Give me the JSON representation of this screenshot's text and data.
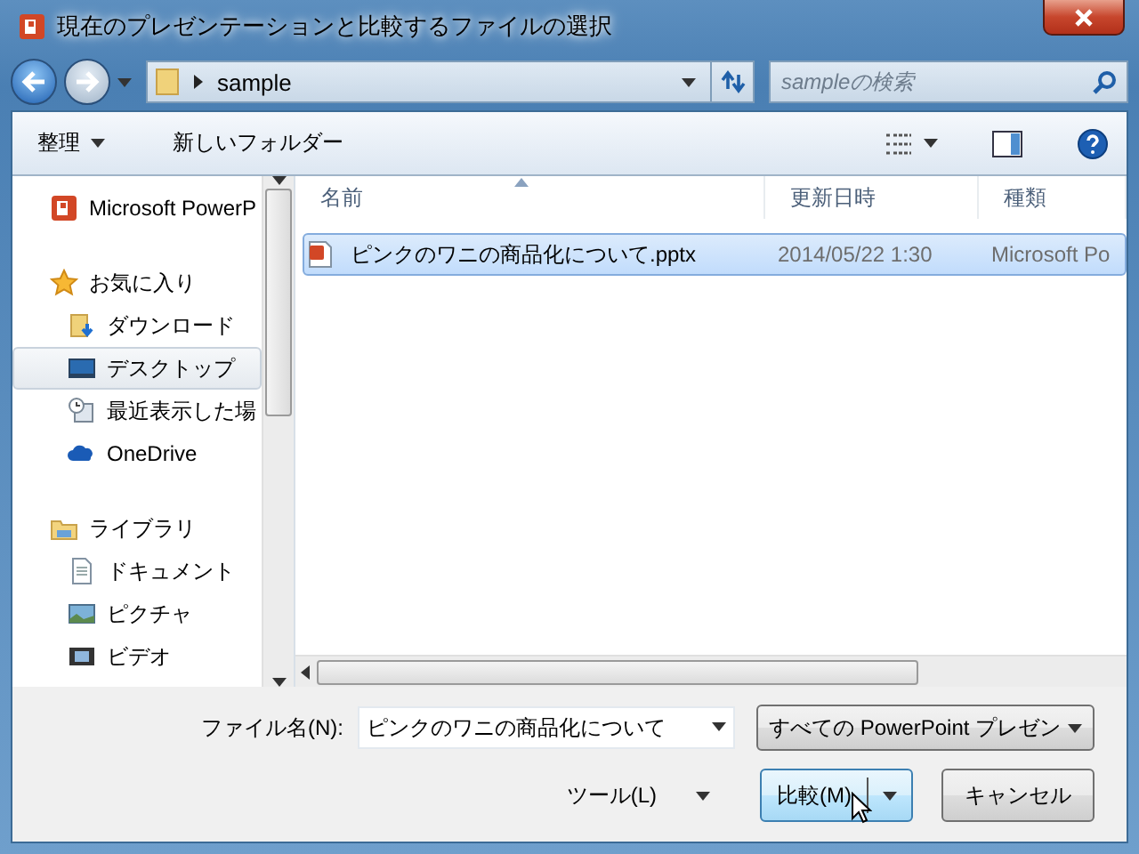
{
  "window": {
    "title": "現在のプレゼンテーションと比較するファイルの選択"
  },
  "address": {
    "path": "sample"
  },
  "search": {
    "placeholder": "sampleの検索"
  },
  "toolbar": {
    "organize": "整理",
    "new_folder": "新しいフォルダー"
  },
  "sidebar": {
    "groups": [
      {
        "label": "Microsoft PowerP",
        "kind": "app",
        "selected": false
      },
      {
        "label": "お気に入り",
        "kind": "star",
        "selected": false,
        "children": [
          {
            "label": "ダウンロード",
            "kind": "download",
            "selected": false
          },
          {
            "label": "デスクトップ",
            "kind": "desktop",
            "selected": true
          },
          {
            "label": "最近表示した場",
            "kind": "recent",
            "selected": false
          },
          {
            "label": "OneDrive",
            "kind": "cloud",
            "selected": false
          }
        ]
      },
      {
        "label": "ライブラリ",
        "kind": "library",
        "selected": false,
        "children": [
          {
            "label": "ドキュメント",
            "kind": "document",
            "selected": false
          },
          {
            "label": "ピクチャ",
            "kind": "picture",
            "selected": false
          },
          {
            "label": "ビデオ",
            "kind": "video",
            "selected": false
          }
        ]
      }
    ]
  },
  "file_list": {
    "columns": [
      {
        "label": "名前",
        "sorted": true
      },
      {
        "label": "更新日時",
        "sorted": false
      },
      {
        "label": "種類",
        "sorted": false
      }
    ],
    "rows": [
      {
        "name": "ピンクのワニの商品化について.pptx",
        "modified": "2014/05/22 1:30",
        "type": "Microsoft Po",
        "selected": true
      }
    ]
  },
  "file_name": {
    "label": "ファイル名(N):",
    "value": "ピンクのワニの商品化について"
  },
  "file_type": {
    "value": "すべての PowerPoint プレゼン"
  },
  "tools": {
    "label": "ツール(L)"
  },
  "buttons": [
    {
      "label": "比較(M)",
      "kind": "split",
      "highlighted": true
    },
    {
      "label": "キャンセル",
      "kind": "plain",
      "highlighted": false
    }
  ]
}
